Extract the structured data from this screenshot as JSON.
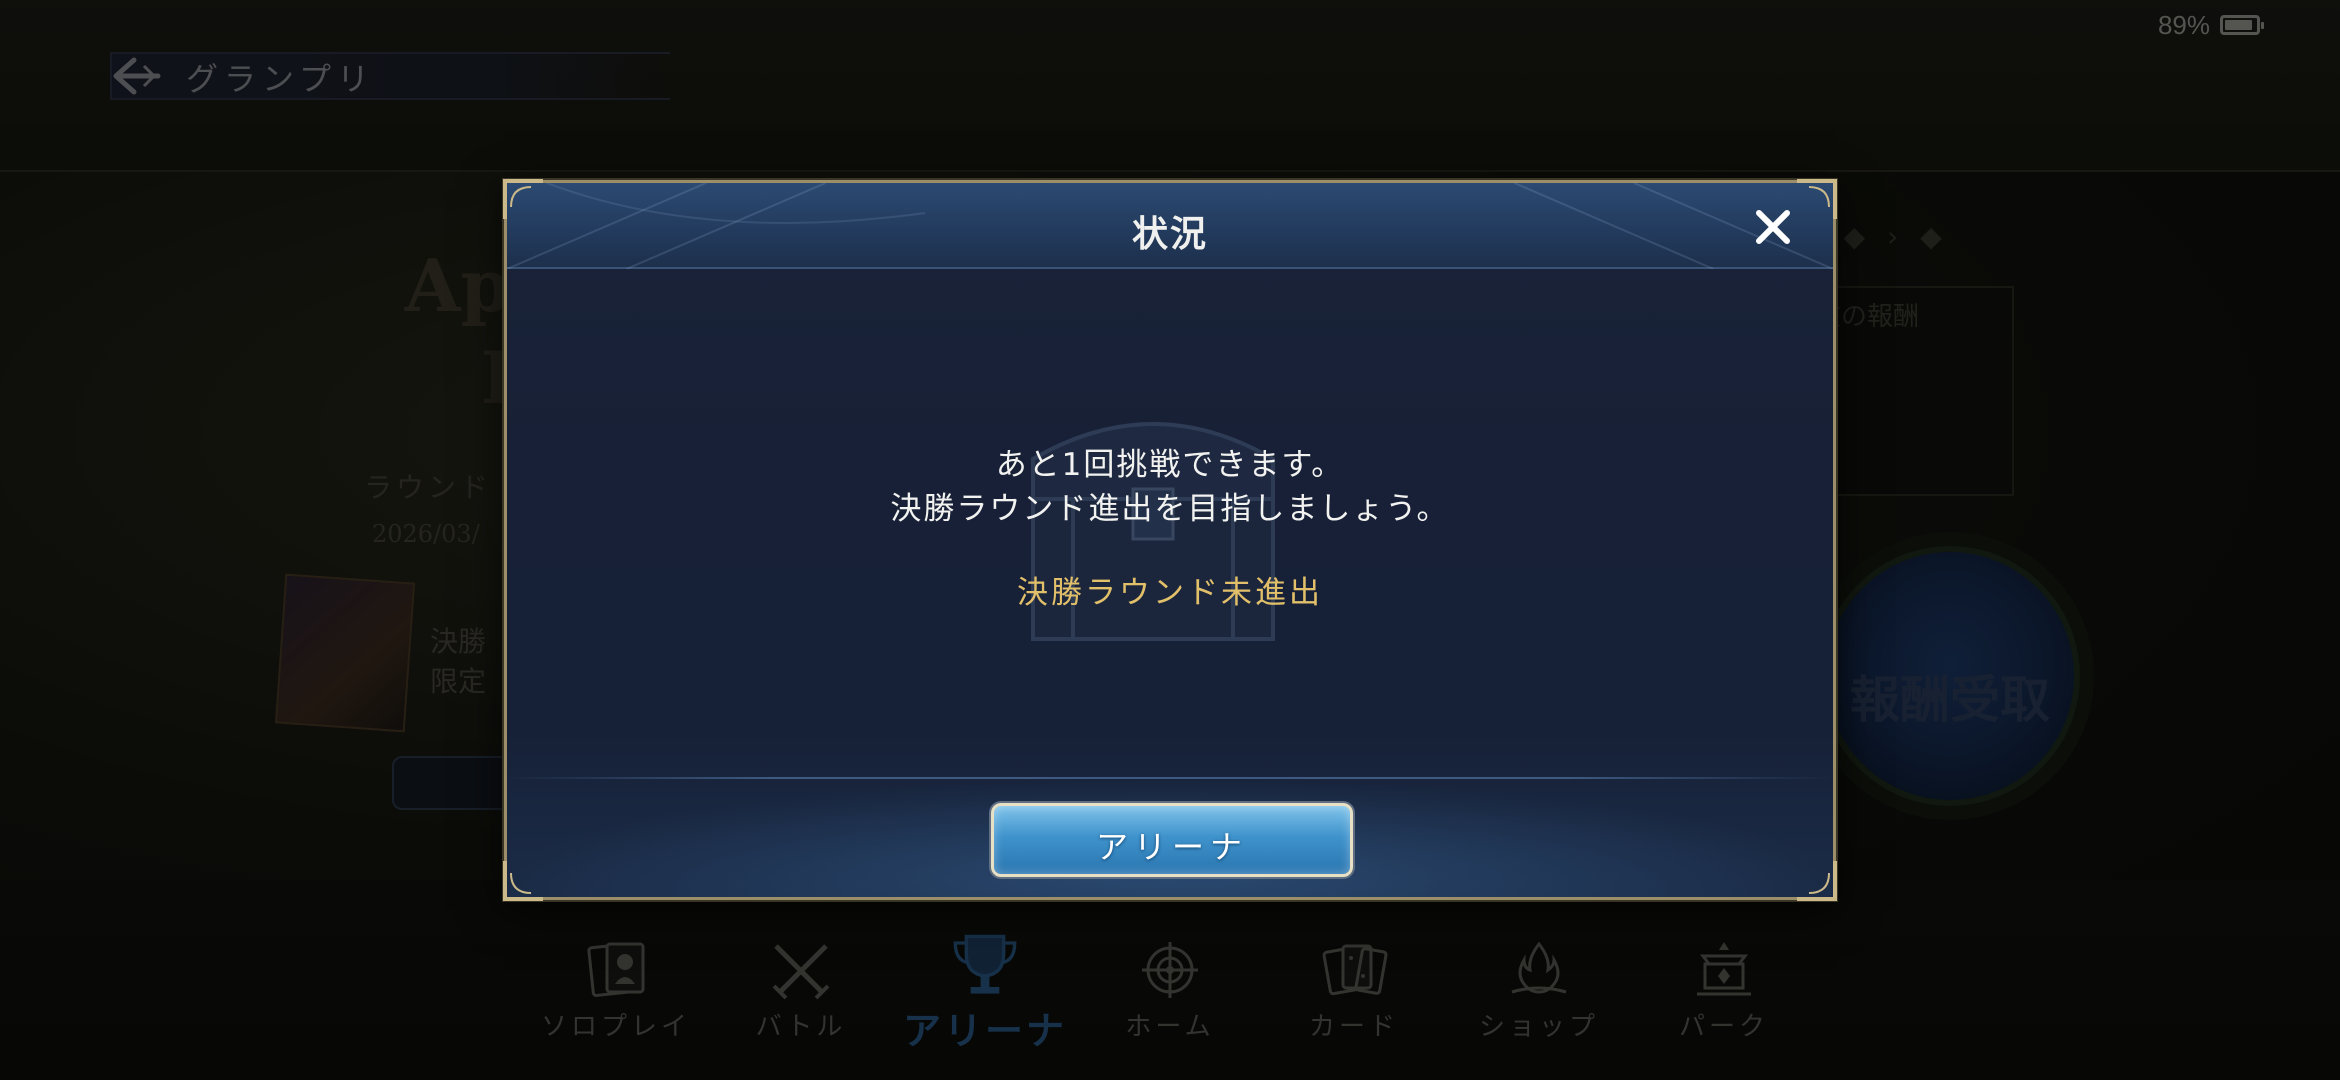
{
  "status_bar": {
    "battery": "89%"
  },
  "header": {
    "back_title": "グランプリ"
  },
  "background": {
    "event_title_line1": "Apocalypse Factory",
    "event_title_line2": "Cup",
    "round_label": "ラウンド",
    "date_partial": "2026/03/",
    "line1": "決勝",
    "line2": "限定",
    "reward_panel_label": "現在の報酬",
    "reward_button": "報酬受取"
  },
  "dialog": {
    "title": "状況",
    "message_line1": "あと1回挑戦できます。",
    "message_line2": "決勝ラウンド進出を目指しましょう。",
    "status": "決勝ラウンド未進出",
    "button_label": "アリーナ"
  },
  "bottom_nav": {
    "items": [
      {
        "label": "ソロプレイ",
        "icon": "solo-play-icon",
        "active": false
      },
      {
        "label": "バトル",
        "icon": "crossed-swords-icon",
        "active": false
      },
      {
        "label": "アリーナ",
        "icon": "trophy-icon",
        "active": true
      },
      {
        "label": "ホーム",
        "icon": "compass-home-icon",
        "active": false
      },
      {
        "label": "カード",
        "icon": "cards-icon",
        "active": false
      },
      {
        "label": "ショップ",
        "icon": "flame-shop-icon",
        "active": false
      },
      {
        "label": "パーク",
        "icon": "shrine-park-icon",
        "active": false
      }
    ]
  },
  "colors": {
    "dialog_border": "#9c8e68",
    "status_gold": "#e2c06a",
    "button_blue": "#3f93cc",
    "active_nav": "#2a5a88"
  }
}
